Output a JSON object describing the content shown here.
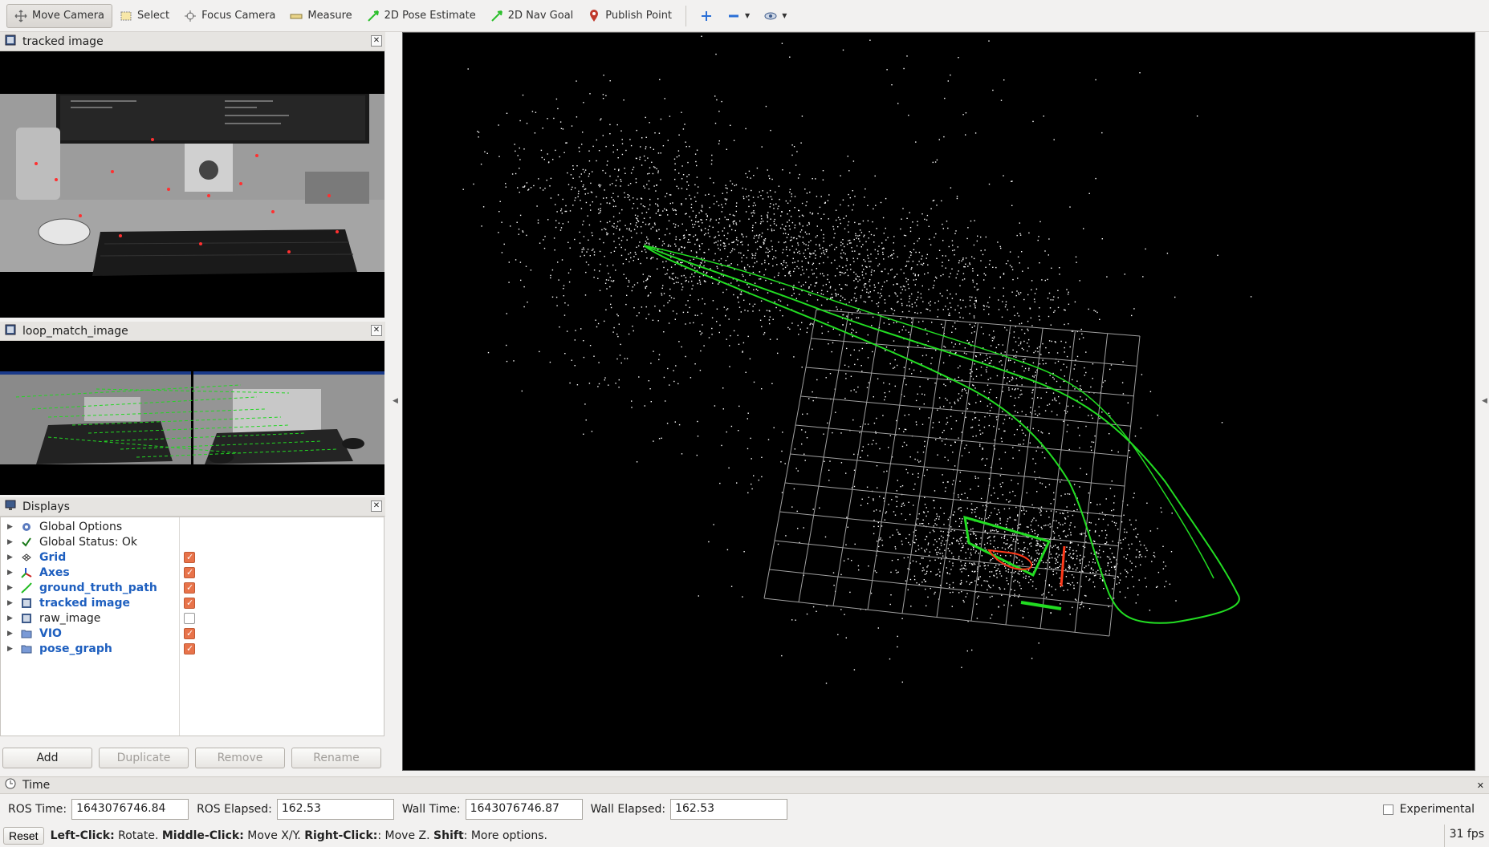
{
  "toolbar": {
    "tools": [
      {
        "label": "Move Camera",
        "icon": "move-camera-icon",
        "active": true
      },
      {
        "label": "Select",
        "icon": "select-icon"
      },
      {
        "label": "Focus Camera",
        "icon": "focus-camera-icon"
      },
      {
        "label": "Measure",
        "icon": "measure-icon"
      },
      {
        "label": "2D Pose Estimate",
        "icon": "pose-estimate-icon"
      },
      {
        "label": "2D Nav Goal",
        "icon": "nav-goal-icon"
      },
      {
        "label": "Publish Point",
        "icon": "publish-point-icon"
      }
    ]
  },
  "panels": {
    "tracked_image": {
      "title": "tracked image"
    },
    "loop_match": {
      "title": "loop_match_image"
    },
    "displays": {
      "title": "Displays"
    }
  },
  "displays": {
    "items": [
      {
        "label": "Global Options",
        "icon": "gear-icon",
        "blue": false,
        "checkbox": null
      },
      {
        "label": "Global Status: Ok",
        "icon": "checkmark-icon",
        "blue": false,
        "checkbox": null
      },
      {
        "label": "Grid",
        "icon": "grid-icon",
        "blue": true,
        "checkbox": true
      },
      {
        "label": "Axes",
        "icon": "axes-icon",
        "blue": true,
        "checkbox": true
      },
      {
        "label": "ground_truth_path",
        "icon": "path-icon",
        "blue": true,
        "checkbox": true
      },
      {
        "label": "tracked image",
        "icon": "image-icon",
        "blue": true,
        "checkbox": true
      },
      {
        "label": "raw_image",
        "icon": "image-icon",
        "blue": false,
        "checkbox": false
      },
      {
        "label": "VIO",
        "icon": "folder-icon",
        "blue": true,
        "checkbox": true
      },
      {
        "label": "pose_graph",
        "icon": "folder-icon",
        "blue": true,
        "checkbox": true
      }
    ],
    "buttons": {
      "add": "Add",
      "duplicate": "Duplicate",
      "remove": "Remove",
      "rename": "Rename"
    }
  },
  "time": {
    "title": "Time",
    "ros_time_label": "ROS Time:",
    "ros_time": "1643076746.84",
    "ros_elapsed_label": "ROS Elapsed:",
    "ros_elapsed": "162.53",
    "wall_time_label": "Wall Time:",
    "wall_time": "1643076746.87",
    "wall_elapsed_label": "Wall Elapsed:",
    "wall_elapsed": "162.53",
    "experimental_label": "Experimental"
  },
  "status": {
    "reset": "Reset",
    "left_click": "Left-Click:",
    "left_click_desc": " Rotate. ",
    "middle_click": "Middle-Click:",
    "middle_click_desc": " Move X/Y. ",
    "right_click": "Right-Click:",
    "right_click_desc": ": Move Z. ",
    "shift": "Shift",
    "shift_desc": ": More options.",
    "fps": "31 fps"
  },
  "colors": {
    "path": "#22dd22",
    "grid": "#a0a0a0",
    "points": "#ffffff",
    "accent_check": "#e8734a",
    "link_blue": "#1e5fbf"
  }
}
